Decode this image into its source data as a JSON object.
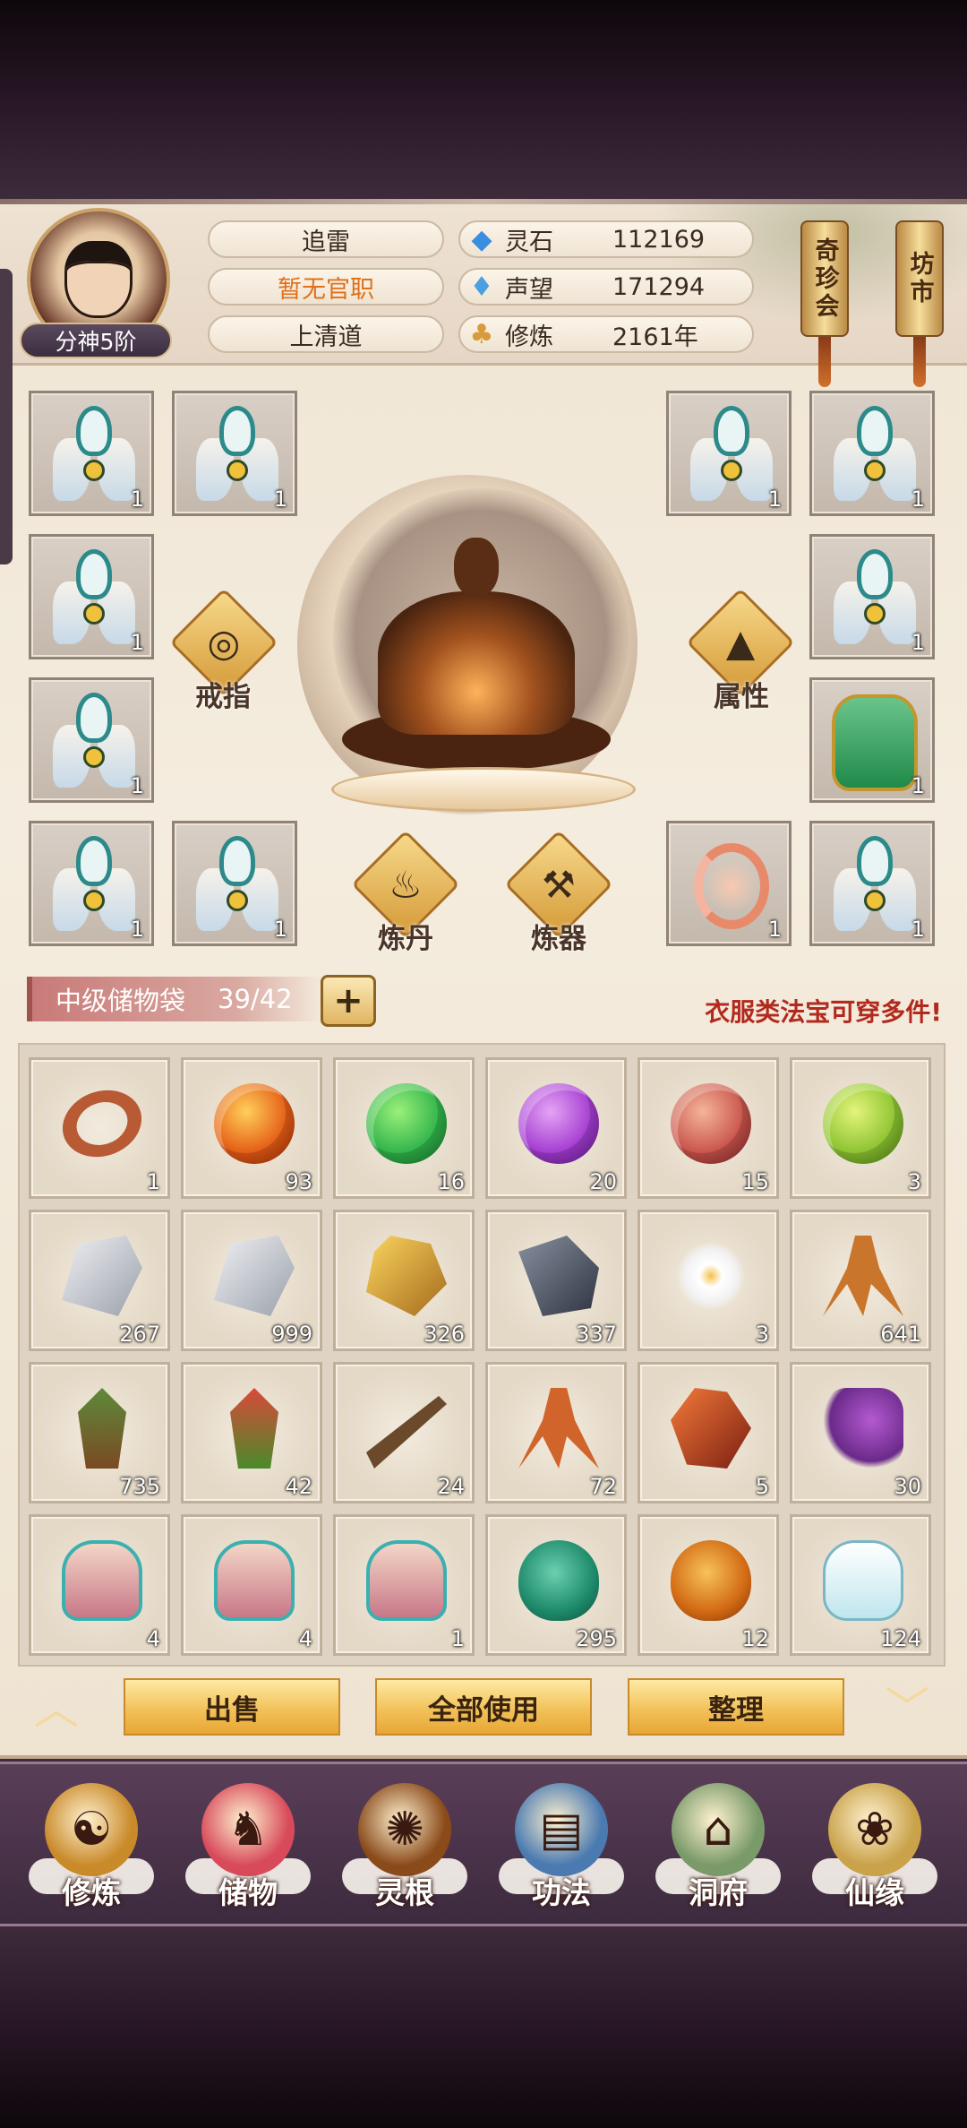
{
  "header": {
    "rank_badge": "分神5阶",
    "name": "追雷",
    "official_title": "暂无官职",
    "sect": "上清道",
    "stats": [
      {
        "icon": "spirit-stone-icon",
        "label": "灵石",
        "value": "112169"
      },
      {
        "icon": "prestige-icon",
        "label": "声望",
        "value": "171294"
      },
      {
        "icon": "cultivation-icon",
        "label": "修炼",
        "value": "2161年"
      }
    ],
    "shop_buttons": [
      "奇珍会",
      "坊市"
    ]
  },
  "equipment": {
    "slot_count": "1",
    "actions": {
      "ring": "戒指",
      "attributes": "属性",
      "alchemy": "炼丹",
      "forging": "炼器"
    }
  },
  "bag": {
    "title": "中级储物袋",
    "capacity": "39/42",
    "expand": "+",
    "hint": "衣服类法宝可穿多件!",
    "items": [
      {
        "icon": "ring-icon",
        "count": "1"
      },
      {
        "icon": "fire-orb-icon",
        "count": "93"
      },
      {
        "icon": "wood-orb-icon",
        "count": "16"
      },
      {
        "icon": "purple-orb-icon",
        "count": "20"
      },
      {
        "icon": "red-orb-icon",
        "count": "15"
      },
      {
        "icon": "lime-orb-icon",
        "count": "3"
      },
      {
        "icon": "silver-ore-icon",
        "count": "267"
      },
      {
        "icon": "silver-ore-icon",
        "count": "999"
      },
      {
        "icon": "gold-ore-icon",
        "count": "326"
      },
      {
        "icon": "iron-ore-icon",
        "count": "337"
      },
      {
        "icon": "white-flower-icon",
        "count": "3"
      },
      {
        "icon": "ginseng-icon",
        "count": "641"
      },
      {
        "icon": "herb-root-icon",
        "count": "735"
      },
      {
        "icon": "berry-herb-icon",
        "count": "42"
      },
      {
        "icon": "branch-fruit-icon",
        "count": "24"
      },
      {
        "icon": "cordyceps-icon",
        "count": "72"
      },
      {
        "icon": "fire-crystal-icon",
        "count": "5"
      },
      {
        "icon": "purple-berry-icon",
        "count": "30"
      },
      {
        "icon": "treasure-bag-icon",
        "count": "4"
      },
      {
        "icon": "treasure-bag-icon",
        "count": "4"
      },
      {
        "icon": "treasure-bag-icon",
        "count": "1"
      },
      {
        "icon": "green-gourd-icon",
        "count": "295"
      },
      {
        "icon": "orange-gourd-icon",
        "count": "12"
      },
      {
        "icon": "porcelain-bottle-icon",
        "count": "124"
      }
    ]
  },
  "bag_actions": {
    "sell": "出售",
    "use_all": "全部使用",
    "sort": "整理"
  },
  "nav": [
    {
      "icon": "cultivate-icon",
      "label": "修炼"
    },
    {
      "icon": "storage-icon",
      "label": "储物"
    },
    {
      "icon": "spirit-root-icon",
      "label": "灵根"
    },
    {
      "icon": "skill-book-icon",
      "label": "功法"
    },
    {
      "icon": "cave-icon",
      "label": "洞府"
    },
    {
      "icon": "fortune-icon",
      "label": "仙缘"
    }
  ],
  "colors": {
    "accent_gold": "#f2c25a",
    "hint_red": "#b22a1e",
    "official_orange": "#e0701a"
  }
}
